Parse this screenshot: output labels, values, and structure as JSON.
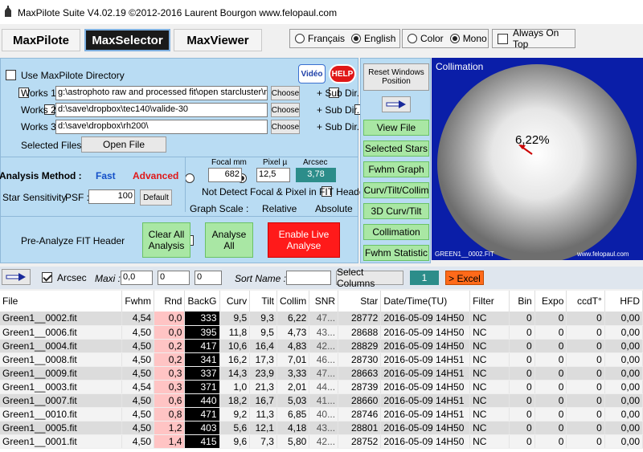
{
  "title": "MaxPilote Suite  V4.02.19  ©2012-2016 Laurent Bourgon  www.felopaul.com",
  "nav": {
    "maxpilote": "MaxPilote",
    "maxselector": "MaxSelector",
    "maxviewer": "MaxViewer"
  },
  "options": {
    "francais": "Français",
    "english": "English",
    "color": "Color",
    "mono": "Mono",
    "always_on_top": "Always On Top"
  },
  "left": {
    "use_dir": "Use MaxPilote Directory",
    "video": "Vidéo",
    "help": "HELP",
    "works1": "Works 1",
    "works1_path": "g:\\astrophoto raw and processed fit\\open starcluster\\m",
    "works2": "Works 2",
    "works2_path": "d:\\save\\dropbox\\tec140\\valide-30",
    "works3": "Works 3",
    "works3_path": "d:\\save\\dropbox\\rh200\\",
    "choose": "Choose",
    "subdir": "+ Sub Dir.",
    "selected_files": "Selected Files :",
    "open_file": "Open File",
    "analysis_method": "Analysis Method :",
    "fast": "Fast",
    "advanced": "Advanced",
    "focal_lbl": "Focal mm",
    "focal_val": "682",
    "pixel_lbl": "Pixel µ",
    "pixel_val": "12,5",
    "arcsec_lbl": "Arcsec",
    "arcsec_val": "3,78",
    "star_sens": "Star Sensitivity",
    "psf": "PSF :",
    "psf_val": "100",
    "default": "Default",
    "not_detect": "Not Detect Focal & Pixel in FIT Header",
    "graph_scale": "Graph Scale :",
    "relative": "Relative",
    "absolute": "Absolute",
    "pre_analyze": "Pre-Analyze FIT Header",
    "clear_all": "Clear All Analysis",
    "analyse_all": "Analyse All",
    "enable_live": "Enable Live Analyse"
  },
  "right": {
    "reset": "Reset Windows Position",
    "view_file": "View File",
    "selected_stars": "Selected Stars",
    "fwhm_graph": "Fwhm Graph",
    "curv": "Curv/Tilt/Collim",
    "curv3d": "3D Curv/Tilt",
    "collimation": "Collimation",
    "fwhm_stat": "Fwhm Statistic"
  },
  "collim": {
    "title": "Collimation",
    "value": "6,22%",
    "file": "GREEN1__0002.FIT",
    "site": "www.felopaul.com"
  },
  "toolbar": {
    "arcsec": "Arcsec",
    "maxi": "Maxi :",
    "v1": "0,0",
    "v2": "0",
    "v3": "0",
    "sort": "Sort Name :",
    "select_columns": "Select Columns",
    "count": "1",
    "excel": "> Excel"
  },
  "columns": [
    "File",
    "Fwhm",
    "Rnd",
    "BackG",
    "Curv",
    "Tilt",
    "Collim",
    "SNR",
    "Star",
    "Date/Time(TU)",
    "Filter",
    "Bin",
    "Expo",
    "ccdT°",
    "HFD"
  ],
  "rows": [
    [
      "Green1__0002.fit",
      "4,54",
      "0,0",
      "333",
      "9,5",
      "9,3",
      "6,22",
      "47...",
      "28772",
      "2016-05-09 14H50",
      "NC",
      "0",
      "0",
      "0",
      "0,00"
    ],
    [
      "Green1__0006.fit",
      "4,50",
      "0,0",
      "395",
      "11,8",
      "9,5",
      "4,73",
      "43...",
      "28688",
      "2016-05-09 14H50",
      "NC",
      "0",
      "0",
      "0",
      "0,00"
    ],
    [
      "Green1__0004.fit",
      "4,50",
      "0,2",
      "417",
      "10,6",
      "16,4",
      "4,83",
      "42...",
      "28829",
      "2016-05-09 14H50",
      "NC",
      "0",
      "0",
      "0",
      "0,00"
    ],
    [
      "Green1__0008.fit",
      "4,50",
      "0,2",
      "341",
      "16,2",
      "17,3",
      "7,01",
      "46...",
      "28730",
      "2016-05-09 14H51",
      "NC",
      "0",
      "0",
      "0",
      "0,00"
    ],
    [
      "Green1__0009.fit",
      "4,50",
      "0,3",
      "337",
      "14,3",
      "23,9",
      "3,33",
      "47...",
      "28663",
      "2016-05-09 14H51",
      "NC",
      "0",
      "0",
      "0",
      "0,00"
    ],
    [
      "Green1__0003.fit",
      "4,54",
      "0,3",
      "371",
      "1,0",
      "21,3",
      "2,01",
      "44...",
      "28739",
      "2016-05-09 14H50",
      "NC",
      "0",
      "0",
      "0",
      "0,00"
    ],
    [
      "Green1__0007.fit",
      "4,50",
      "0,6",
      "440",
      "18,2",
      "16,7",
      "5,03",
      "41...",
      "28660",
      "2016-05-09 14H51",
      "NC",
      "0",
      "0",
      "0",
      "0,00"
    ],
    [
      "Green1__0010.fit",
      "4,50",
      "0,8",
      "471",
      "9,2",
      "11,3",
      "6,85",
      "40...",
      "28746",
      "2016-05-09 14H51",
      "NC",
      "0",
      "0",
      "0",
      "0,00"
    ],
    [
      "Green1__0005.fit",
      "4,50",
      "1,2",
      "403",
      "5,6",
      "12,1",
      "4,18",
      "43...",
      "28801",
      "2016-05-09 14H50",
      "NC",
      "0",
      "0",
      "0",
      "0,00"
    ],
    [
      "Green1__0001.fit",
      "4,50",
      "1,4",
      "415",
      "9,6",
      "7,3",
      "5,80",
      "42...",
      "28752",
      "2016-05-09 14H50",
      "NC",
      "0",
      "0",
      "0",
      "0,00"
    ]
  ]
}
